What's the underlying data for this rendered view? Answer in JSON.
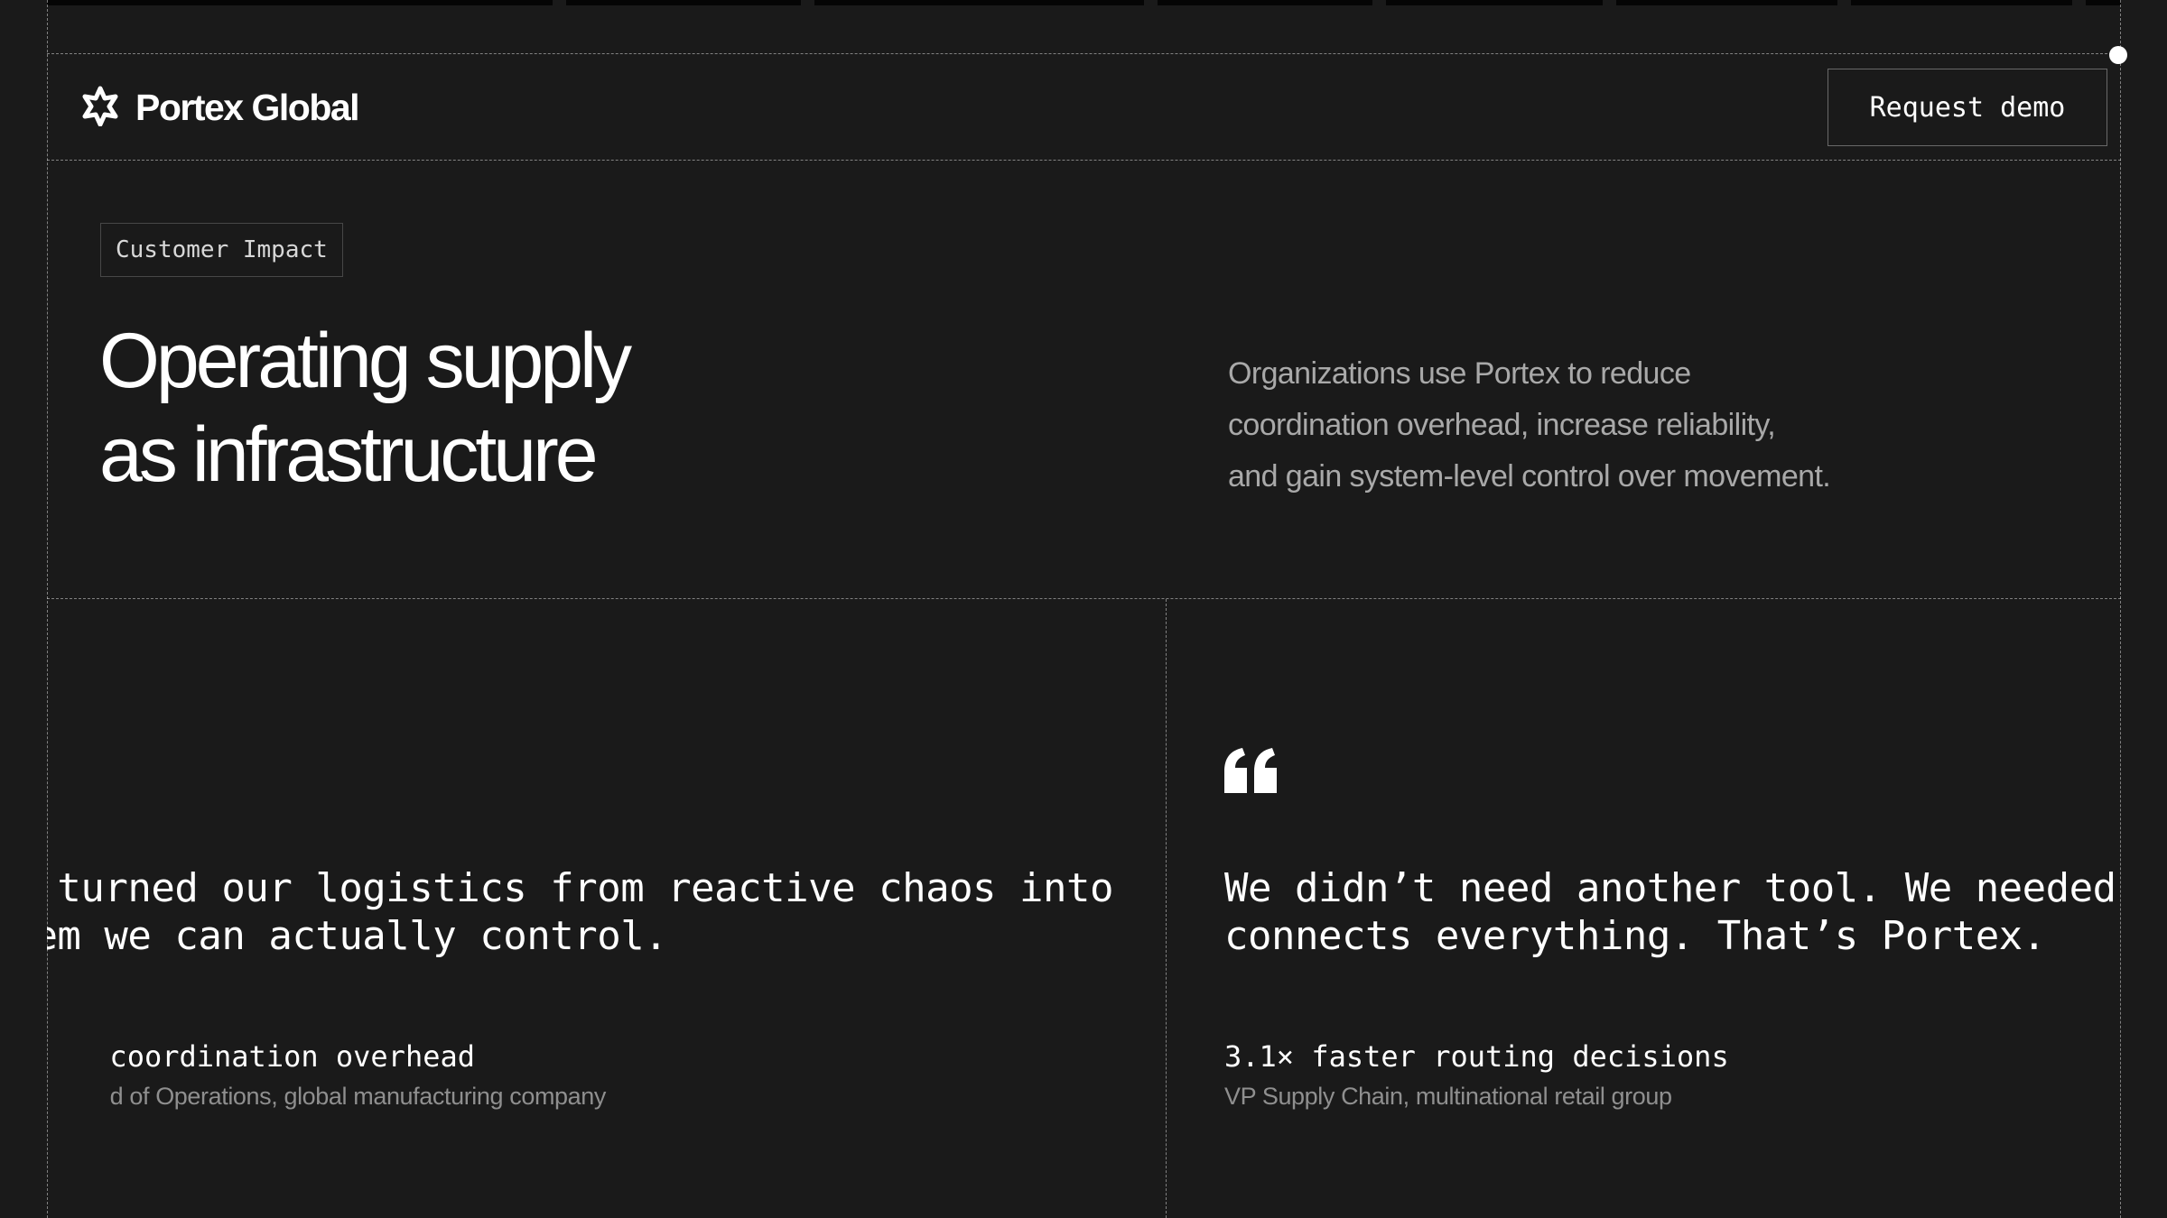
{
  "header": {
    "brand_name": "Portex Global",
    "cta_label": "Request demo",
    "logo_icon": "starburst-logo-icon"
  },
  "hero": {
    "badge": "Customer Impact",
    "title_line1": "Operating supply",
    "title_line2": "as infrastructure",
    "description_line1": "Organizations use Portex to reduce",
    "description_line2": "coordination overhead, increase reliability,",
    "description_line3": "and gain system-level control over movement."
  },
  "testimonials": [
    {
      "quote_line1": "rtex turned our logistics from reactive chaos into",
      "quote_line2": "system we can actually control.",
      "metric": "coordination overhead",
      "attribution": "d of Operations, global manufacturing company"
    },
    {
      "quote_icon": "quote-icon",
      "quote_line1": "We didn’t need another tool. We needed a la",
      "quote_line2": "connects everything. That’s Portex.",
      "metric": "3.1× faster routing decisions",
      "attribution": "VP Supply Chain, multinational retail group"
    }
  ],
  "colors": {
    "background": "#1a1a1a",
    "text_primary": "#ffffff",
    "text_secondary": "#a9a9a9",
    "text_muted": "#8f8f8f"
  }
}
